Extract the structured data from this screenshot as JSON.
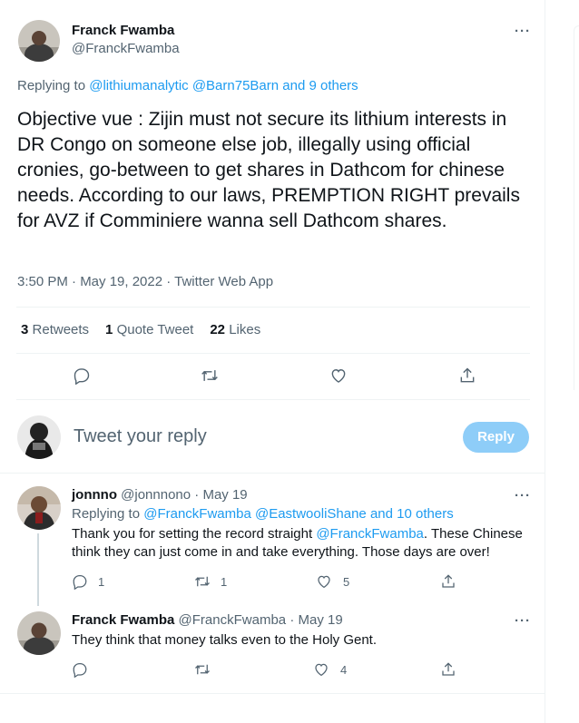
{
  "main_tweet": {
    "author_name": "Franck Fwamba",
    "author_handle": "@FranckFwamba",
    "replying_label": "Replying to",
    "replying_mentions": "@lithiumanalytic @Barn75Barn",
    "replying_others": "and 9 others",
    "text": "Objective vue : Zijin must not secure its lithium interests in DR Congo on someone else job, illegally using official cronies, go-between to get shares in Dathcom for chinese needs.  According to our laws, PREMPTION RIGHT prevails for AVZ if Comminiere wanna sell Dathcom shares.",
    "timestamp": "3:50 PM · May 19, 2022 · Twitter Web App",
    "retweets_count": "3",
    "retweets_label": "Retweets",
    "quote_count": "1",
    "quote_label": "Quote Tweet",
    "likes_count": "22",
    "likes_label": "Likes"
  },
  "composer": {
    "placeholder": "Tweet your reply",
    "button_label": "Reply"
  },
  "replies": [
    {
      "author_name": "jonnno",
      "author_handle": "@jonnnono",
      "date": "· May 19",
      "replying_label": "Replying to",
      "replying_mentions": "@FranckFwamba @EastwooliShane",
      "replying_others": "and 10 others",
      "text_before": "Thank you for setting the record straight ",
      "text_mention": "@FranckFwamba",
      "text_after": ". These Chinese think they can just come in and take everything. Those days are over!",
      "reply_count": "1",
      "retweet_count": "1",
      "like_count": "5"
    },
    {
      "author_name": "Franck Fwamba",
      "author_handle": "@FranckFwamba",
      "date": "· May 19",
      "text": "They think that money talks even to the Holy Gent.",
      "like_count": "4"
    }
  ],
  "icons": {
    "more": "more-horizontal-icon",
    "reply": "reply-icon",
    "retweet": "retweet-icon",
    "like": "heart-icon",
    "share": "share-icon"
  },
  "colors": {
    "accent": "#1d9bf0",
    "reply_button_disabled": "#8ecdf8",
    "muted_text": "#536471"
  }
}
